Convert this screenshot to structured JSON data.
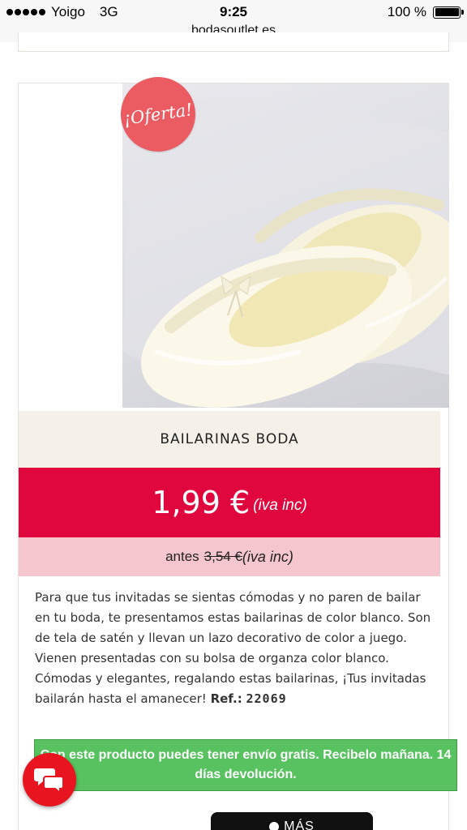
{
  "status_bar": {
    "carrier": "Yoigo",
    "network": "3G",
    "time": "9:25",
    "battery": "100 %"
  },
  "browser": {
    "url": "bodasoutlet.es"
  },
  "product": {
    "badge": "¡Oferta!",
    "name": "BAILARINAS BODA",
    "price": "1,99 €",
    "price_note": "(iva inc)",
    "before_label": "antes",
    "before_price": "3,54 €",
    "before_note": "(iva inc)",
    "description": "Para que tus invitadas se sientas cómodas y no paren de bailar en tu boda, te presentamos estas bailarinas de color blanco. Son de tela de satén y llevan un lazo decorativo de color a juego. Vienen presentadas con su bolsa de organza color blanco. Cómodas y elegantes, regalando estas bailarinas, ¡Tus invitadas bailarán hasta el amanecer!",
    "ref_label": "Ref.:",
    "ref_value": "22069",
    "image_icon": "ballet-flats-photo"
  },
  "shipping_banner": "Con este producto puedes tener envío gratis. Recibelo mañana. 14 días devolución.",
  "chat": {
    "icon": "chat-bubbles-icon"
  },
  "more_button": {
    "label": "MÁS"
  },
  "colors": {
    "price_band": "#e0073f",
    "before_band": "#f5c6cd",
    "name_band": "#f6f1e8",
    "shipping": "#57c25f",
    "chat": "#e8141f",
    "badge": "#ea5b62"
  }
}
